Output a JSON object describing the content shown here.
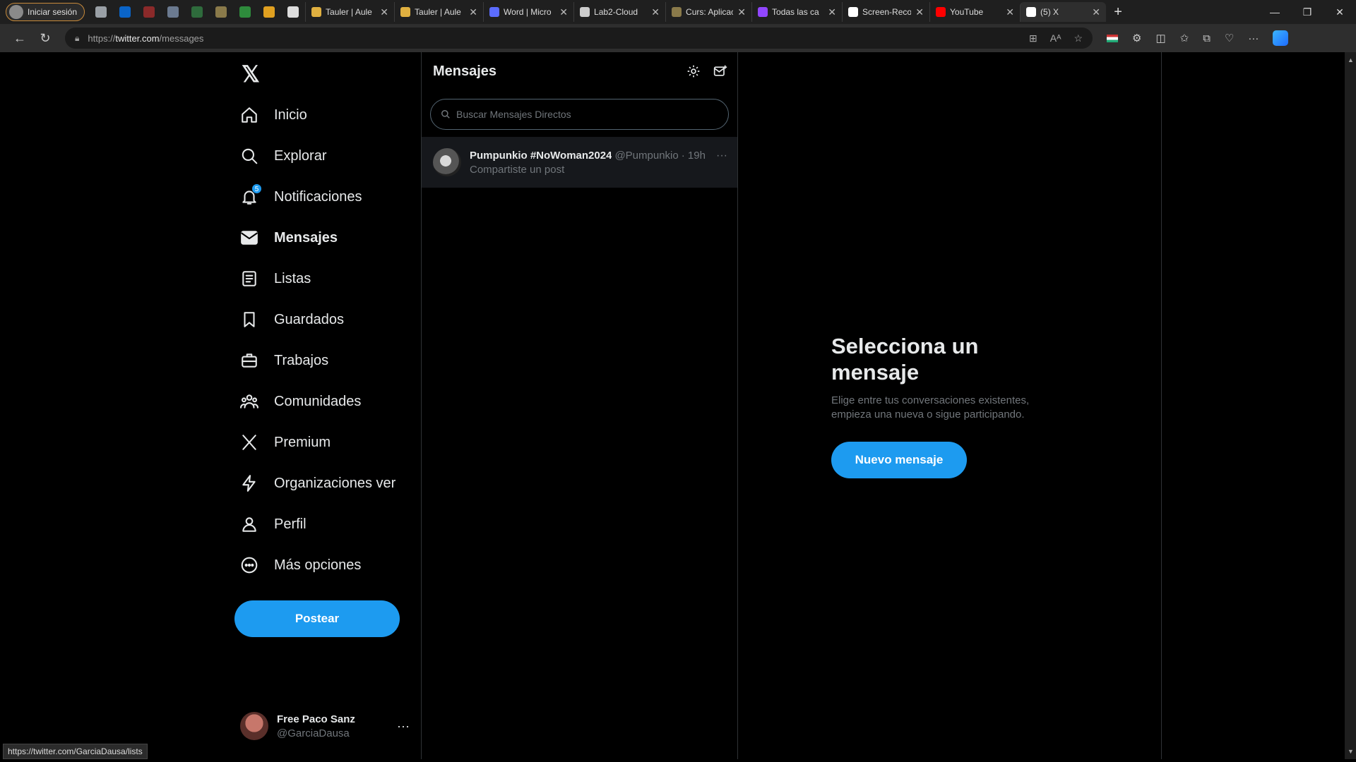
{
  "browser": {
    "profile_label": "Iniciar sesión",
    "pinned_icons": [
      {
        "name": "workspaces-icon",
        "color": "#9aa0a6"
      },
      {
        "name": "outlook-icon",
        "color": "#0a64c8"
      },
      {
        "name": "app-icon-red",
        "color": "#8b2a2a"
      },
      {
        "name": "app-icon-gray",
        "color": "#6b7a90"
      },
      {
        "name": "app-icon-green",
        "color": "#2e6b3c"
      },
      {
        "name": "app-icon-diamond",
        "color": "#8a7a4a"
      },
      {
        "name": "uab-icon",
        "color": "#2e8b3c"
      },
      {
        "name": "app-icon-orange",
        "color": "#e0a020"
      },
      {
        "name": "chatgpt-icon",
        "color": "#dddddd"
      }
    ],
    "tabs": [
      {
        "title": "Tauler | Aule",
        "color": "#e0b040"
      },
      {
        "title": "Tauler | Aule",
        "color": "#e0b040"
      },
      {
        "title": "Word | Micro",
        "color": "#5b6cff"
      },
      {
        "title": "Lab2-Cloud",
        "color": "#cccccc"
      },
      {
        "title": "Curs: Aplicac",
        "color": "#8a7a4a"
      },
      {
        "title": "Todas las ca",
        "color": "#9146ff"
      },
      {
        "title": "Screen-Reco",
        "color": "#ffffff"
      },
      {
        "title": "YouTube",
        "color": "#ff0000"
      },
      {
        "title": "(5) X",
        "color": "#ffffff"
      }
    ],
    "url_prefix": "https://",
    "url_host": "twitter.com",
    "url_path": "/messages",
    "status_url": "https://twitter.com/GarciaDausa/lists"
  },
  "nav": {
    "items": [
      {
        "label": "Inicio",
        "icon": "home-icon"
      },
      {
        "label": "Explorar",
        "icon": "search-icon"
      },
      {
        "label": "Notificaciones",
        "icon": "bell-icon",
        "badge": "5"
      },
      {
        "label": "Mensajes",
        "icon": "mail-icon"
      },
      {
        "label": "Listas",
        "icon": "list-icon"
      },
      {
        "label": "Guardados",
        "icon": "bookmark-icon"
      },
      {
        "label": "Trabajos",
        "icon": "briefcase-icon"
      },
      {
        "label": "Comunidades",
        "icon": "communities-icon"
      },
      {
        "label": "Premium",
        "icon": "x-logo-icon"
      },
      {
        "label": "Organizaciones ver",
        "icon": "lightning-icon"
      },
      {
        "label": "Perfil",
        "icon": "person-icon"
      },
      {
        "label": "Más opciones",
        "icon": "more-circle-icon"
      }
    ],
    "post_label": "Postear",
    "account": {
      "name": "Free Paco Sanz",
      "handle": "@GarciaDausa"
    }
  },
  "messages": {
    "title": "Mensajes",
    "search_placeholder": "Buscar Mensajes Directos",
    "conversations": [
      {
        "name": "Pumpunkio #NoWoman2024",
        "handle": "@Pumpunkio",
        "time": "· 19h",
        "preview": "Compartiste un post"
      }
    ]
  },
  "detail": {
    "title": "Selecciona un mensaje",
    "description": "Elige entre tus conversaciones existentes, empieza una nueva o sigue participando.",
    "button": "Nuevo mensaje"
  },
  "colors": {
    "accent": "#1d9bf0",
    "muted": "#71767b",
    "border": "#2f3336"
  }
}
